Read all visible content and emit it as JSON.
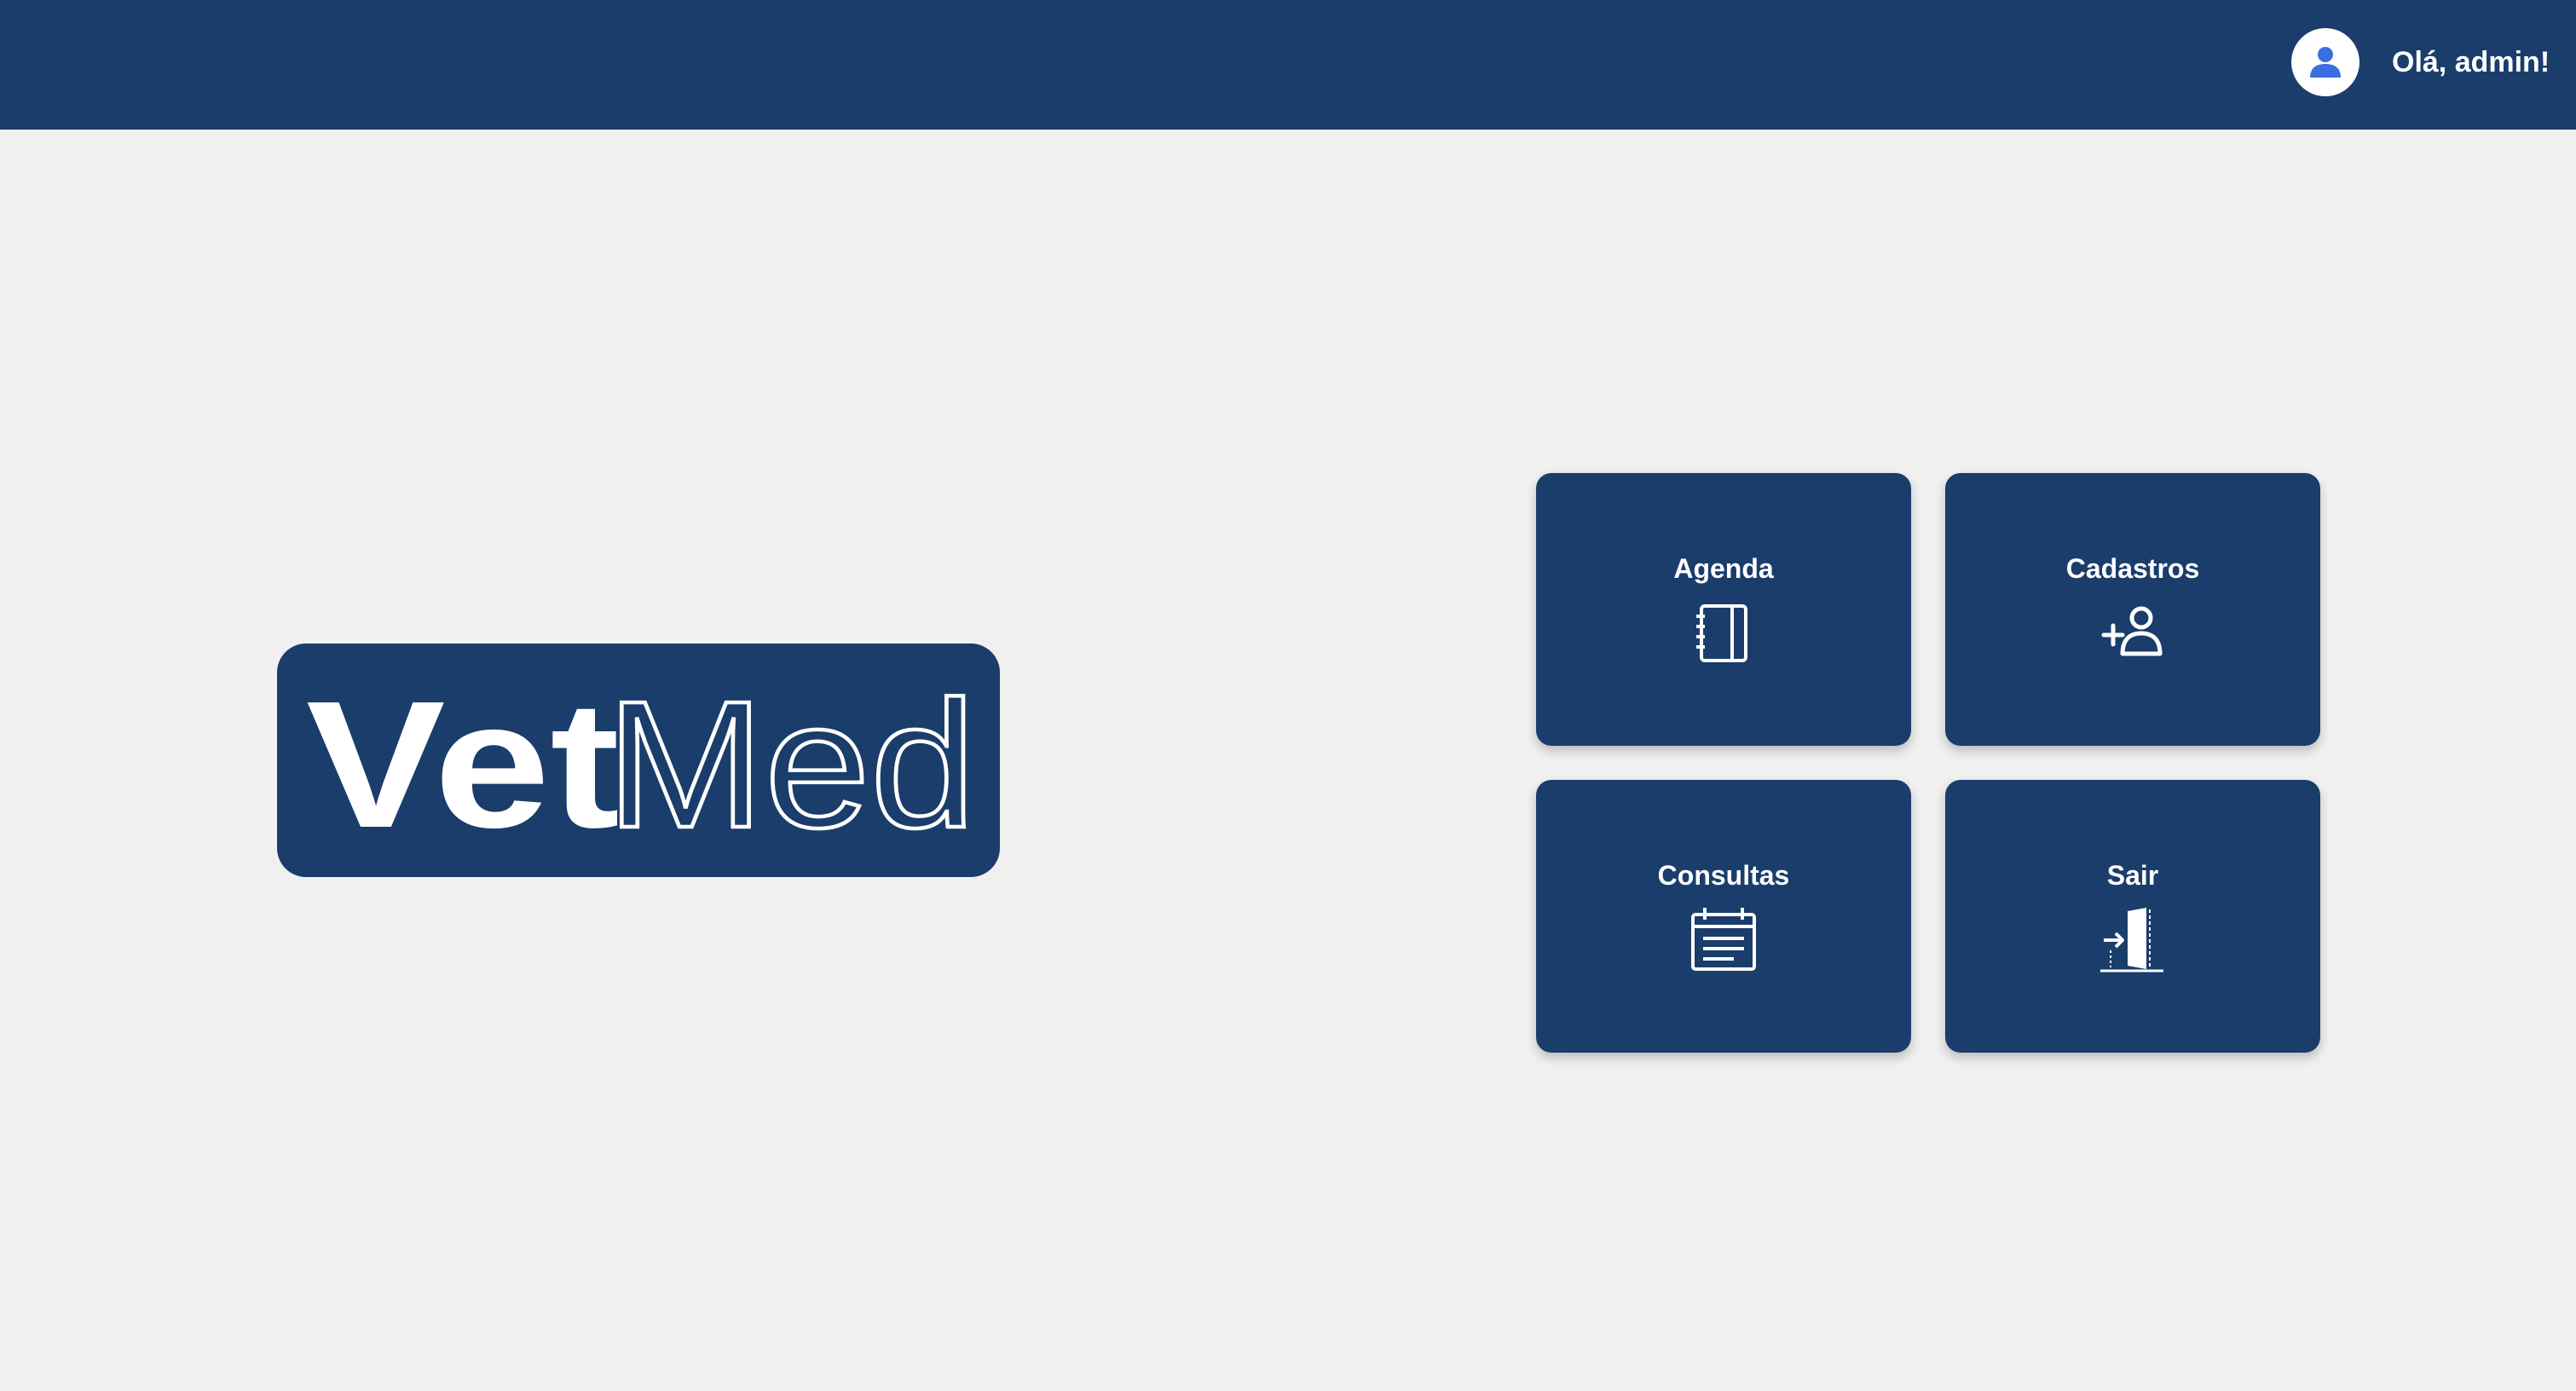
{
  "header": {
    "greeting": "Olá, admin!",
    "avatar_icon": "user-avatar-icon",
    "background": "#1a3d6b"
  },
  "logo": {
    "text_solid": "Vet",
    "text_outline": "Med"
  },
  "tiles": [
    {
      "label": "Agenda",
      "icon": "notebook-icon"
    },
    {
      "label": "Cadastros",
      "icon": "add-user-icon"
    },
    {
      "label": "Consultas",
      "icon": "calendar-list-icon"
    },
    {
      "label": "Sair",
      "icon": "exit-door-icon"
    }
  ],
  "colors": {
    "primary": "#1a3d6b",
    "background": "#f0f0f0",
    "avatar_accent": "#3b6fe0",
    "text": "#ffffff"
  }
}
